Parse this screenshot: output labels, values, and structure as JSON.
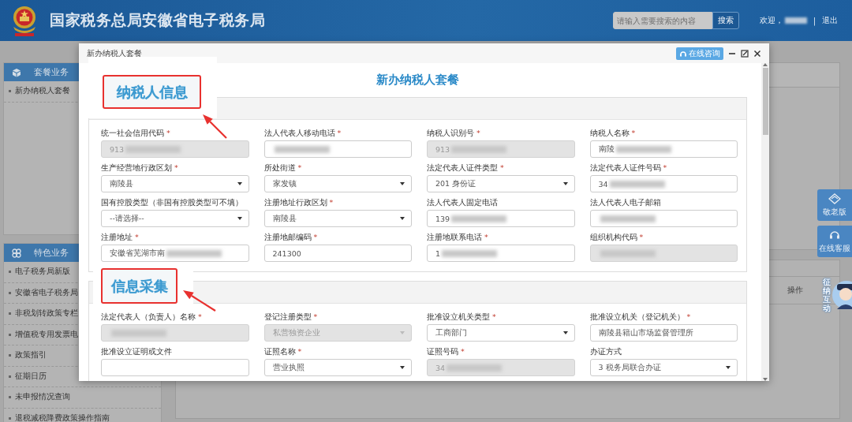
{
  "header": {
    "title": "国家税务总局安徽省电子税务局",
    "search": {
      "placeholder": "请输入需要搜索的内容",
      "button": "搜索"
    },
    "welcome": "欢迎，",
    "separator": "|",
    "logout": "退出"
  },
  "sidebar": {
    "panels": [
      {
        "title": "套餐业务",
        "items": [
          {
            "label": "新办纳税人套餐"
          }
        ]
      },
      {
        "title": "特色业务",
        "items": [
          {
            "label": "电子税务局新版"
          },
          {
            "label": "安徽省电子税务局"
          },
          {
            "label": "非税划转政策专栏"
          },
          {
            "label": "增值税专用发票电"
          },
          {
            "label": "政策指引"
          },
          {
            "label": "征期日历"
          },
          {
            "label": "未申报情况查询"
          },
          {
            "label": "退税减税降费政策操作指南"
          }
        ]
      }
    ]
  },
  "background_table": {
    "column_header": "操作"
  },
  "modal": {
    "title": "新办纳税人套餐",
    "consult_button": "在线咨询",
    "heading": "新办纳税人套餐",
    "sections": [
      {
        "callout": "纳税人信息",
        "fields": [
          {
            "label": "统一社会信用代码",
            "required_mark": "*",
            "kind": "input",
            "disabled": true,
            "value": "913",
            "redacted": true
          },
          {
            "label": "法人代表人移动电话",
            "required_mark": "*",
            "kind": "input",
            "disabled": false,
            "redacted": true
          },
          {
            "label": "纳税人识别号",
            "required_mark": "*",
            "kind": "input",
            "disabled": true,
            "value": "913",
            "redacted": true
          },
          {
            "label": "纳税人名称",
            "required_mark": "*",
            "kind": "input",
            "disabled": false,
            "value": "南陵",
            "redacted": true
          },
          {
            "label": "生产经营地行政区划",
            "required_mark": "*",
            "kind": "select",
            "disabled": false,
            "value": "南陵县",
            "redacted": false
          },
          {
            "label": "所处街道",
            "required_mark": "*",
            "kind": "select",
            "disabled": false,
            "value": "家发镇",
            "redacted": false
          },
          {
            "label": "法定代表人证件类型",
            "required_mark": "*",
            "kind": "select",
            "disabled": false,
            "value": "201 身份证",
            "redacted": false
          },
          {
            "label": "法定代表人证件号码",
            "required_mark": "*",
            "kind": "input",
            "disabled": false,
            "value": "34",
            "redacted": true
          },
          {
            "label": "国有控股类型（非国有控股类型可不填）",
            "kind": "select",
            "disabled": false,
            "value": "--请选择--",
            "redacted": false
          },
          {
            "label": "注册地址行政区划",
            "required_mark": "*",
            "kind": "select",
            "disabled": false,
            "value": "南陵县",
            "redacted": false
          },
          {
            "label": "法人代表人固定电话",
            "kind": "input",
            "disabled": false,
            "value": "139",
            "redacted": true
          },
          {
            "label": "法人代表人电子邮箱",
            "kind": "input",
            "disabled": false,
            "redacted": true
          },
          {
            "label": "注册地址",
            "required_mark": "*",
            "kind": "input",
            "disabled": false,
            "value": "安徽省芜湖市南",
            "redacted": true
          },
          {
            "label": "注册地邮编码",
            "required_mark": "*",
            "kind": "input",
            "disabled": false,
            "value": "241300",
            "redacted": false
          },
          {
            "label": "注册地联系电话",
            "required_mark": "*",
            "kind": "input",
            "disabled": false,
            "value": "1",
            "redacted": true
          },
          {
            "label": "组织机构代码",
            "required_mark": "*",
            "kind": "input",
            "disabled": true,
            "redacted": true
          }
        ]
      },
      {
        "callout": "信息采集",
        "fields": [
          {
            "label": "法定代表人（负责人）名称",
            "required_mark": "*",
            "kind": "input",
            "disabled": true,
            "redacted": true
          },
          {
            "label": "登记注册类型",
            "required_mark": "*",
            "kind": "select",
            "disabled": true,
            "value": "私营独资企业",
            "redacted": false
          },
          {
            "label": "批准设立机关类型",
            "required_mark": "*",
            "kind": "select",
            "disabled": false,
            "value": "工商部门",
            "redacted": false
          },
          {
            "label": "批准设立机关（登记机关）",
            "required_mark": "*",
            "kind": "input",
            "disabled": false,
            "value": "南陵县籍山市场监督管理所",
            "redacted": false
          },
          {
            "label": "批准设立证明或文件",
            "kind": "input",
            "disabled": false,
            "redacted": false
          },
          {
            "label": "证照名称",
            "required_mark": "*",
            "kind": "select",
            "disabled": false,
            "value": "营业执照",
            "redacted": false
          },
          {
            "label": "证照号码",
            "required_mark": "*",
            "kind": "input",
            "disabled": true,
            "value": "34",
            "redacted": true
          },
          {
            "label": "办证方式",
            "kind": "select",
            "disabled": false,
            "value": "3 税务局联合办证",
            "redacted": false
          }
        ]
      }
    ]
  },
  "float_tools": [
    {
      "label": "敬老版"
    },
    {
      "label": "在线客服"
    }
  ],
  "mascot": {
    "label": "征纳互动"
  }
}
